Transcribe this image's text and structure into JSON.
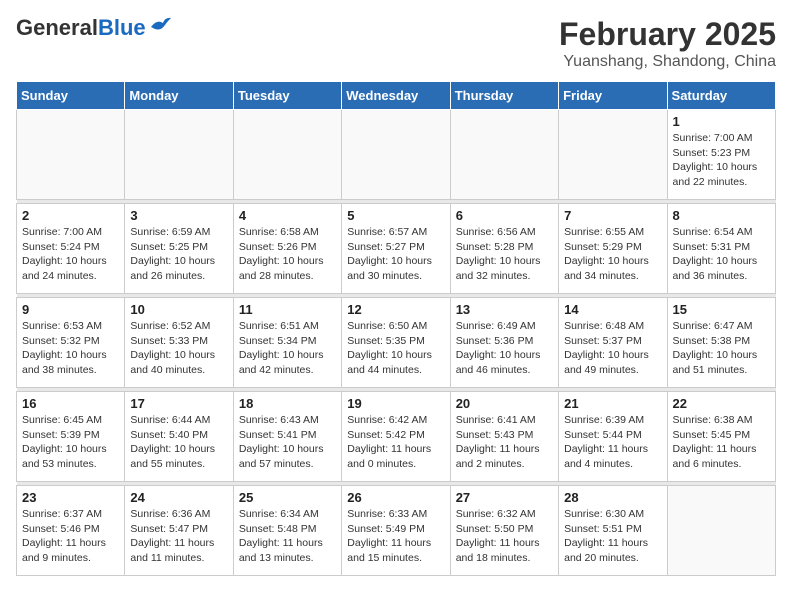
{
  "header": {
    "logo_general": "General",
    "logo_blue": "Blue",
    "month_year": "February 2025",
    "location": "Yuanshang, Shandong, China"
  },
  "weekdays": [
    "Sunday",
    "Monday",
    "Tuesday",
    "Wednesday",
    "Thursday",
    "Friday",
    "Saturday"
  ],
  "weeks": [
    [
      {
        "day": "",
        "info": ""
      },
      {
        "day": "",
        "info": ""
      },
      {
        "day": "",
        "info": ""
      },
      {
        "day": "",
        "info": ""
      },
      {
        "day": "",
        "info": ""
      },
      {
        "day": "",
        "info": ""
      },
      {
        "day": "1",
        "info": "Sunrise: 7:00 AM\nSunset: 5:23 PM\nDaylight: 10 hours\nand 22 minutes."
      }
    ],
    [
      {
        "day": "2",
        "info": "Sunrise: 7:00 AM\nSunset: 5:24 PM\nDaylight: 10 hours\nand 24 minutes."
      },
      {
        "day": "3",
        "info": "Sunrise: 6:59 AM\nSunset: 5:25 PM\nDaylight: 10 hours\nand 26 minutes."
      },
      {
        "day": "4",
        "info": "Sunrise: 6:58 AM\nSunset: 5:26 PM\nDaylight: 10 hours\nand 28 minutes."
      },
      {
        "day": "5",
        "info": "Sunrise: 6:57 AM\nSunset: 5:27 PM\nDaylight: 10 hours\nand 30 minutes."
      },
      {
        "day": "6",
        "info": "Sunrise: 6:56 AM\nSunset: 5:28 PM\nDaylight: 10 hours\nand 32 minutes."
      },
      {
        "day": "7",
        "info": "Sunrise: 6:55 AM\nSunset: 5:29 PM\nDaylight: 10 hours\nand 34 minutes."
      },
      {
        "day": "8",
        "info": "Sunrise: 6:54 AM\nSunset: 5:31 PM\nDaylight: 10 hours\nand 36 minutes."
      }
    ],
    [
      {
        "day": "9",
        "info": "Sunrise: 6:53 AM\nSunset: 5:32 PM\nDaylight: 10 hours\nand 38 minutes."
      },
      {
        "day": "10",
        "info": "Sunrise: 6:52 AM\nSunset: 5:33 PM\nDaylight: 10 hours\nand 40 minutes."
      },
      {
        "day": "11",
        "info": "Sunrise: 6:51 AM\nSunset: 5:34 PM\nDaylight: 10 hours\nand 42 minutes."
      },
      {
        "day": "12",
        "info": "Sunrise: 6:50 AM\nSunset: 5:35 PM\nDaylight: 10 hours\nand 44 minutes."
      },
      {
        "day": "13",
        "info": "Sunrise: 6:49 AM\nSunset: 5:36 PM\nDaylight: 10 hours\nand 46 minutes."
      },
      {
        "day": "14",
        "info": "Sunrise: 6:48 AM\nSunset: 5:37 PM\nDaylight: 10 hours\nand 49 minutes."
      },
      {
        "day": "15",
        "info": "Sunrise: 6:47 AM\nSunset: 5:38 PM\nDaylight: 10 hours\nand 51 minutes."
      }
    ],
    [
      {
        "day": "16",
        "info": "Sunrise: 6:45 AM\nSunset: 5:39 PM\nDaylight: 10 hours\nand 53 minutes."
      },
      {
        "day": "17",
        "info": "Sunrise: 6:44 AM\nSunset: 5:40 PM\nDaylight: 10 hours\nand 55 minutes."
      },
      {
        "day": "18",
        "info": "Sunrise: 6:43 AM\nSunset: 5:41 PM\nDaylight: 10 hours\nand 57 minutes."
      },
      {
        "day": "19",
        "info": "Sunrise: 6:42 AM\nSunset: 5:42 PM\nDaylight: 11 hours\nand 0 minutes."
      },
      {
        "day": "20",
        "info": "Sunrise: 6:41 AM\nSunset: 5:43 PM\nDaylight: 11 hours\nand 2 minutes."
      },
      {
        "day": "21",
        "info": "Sunrise: 6:39 AM\nSunset: 5:44 PM\nDaylight: 11 hours\nand 4 minutes."
      },
      {
        "day": "22",
        "info": "Sunrise: 6:38 AM\nSunset: 5:45 PM\nDaylight: 11 hours\nand 6 minutes."
      }
    ],
    [
      {
        "day": "23",
        "info": "Sunrise: 6:37 AM\nSunset: 5:46 PM\nDaylight: 11 hours\nand 9 minutes."
      },
      {
        "day": "24",
        "info": "Sunrise: 6:36 AM\nSunset: 5:47 PM\nDaylight: 11 hours\nand 11 minutes."
      },
      {
        "day": "25",
        "info": "Sunrise: 6:34 AM\nSunset: 5:48 PM\nDaylight: 11 hours\nand 13 minutes."
      },
      {
        "day": "26",
        "info": "Sunrise: 6:33 AM\nSunset: 5:49 PM\nDaylight: 11 hours\nand 15 minutes."
      },
      {
        "day": "27",
        "info": "Sunrise: 6:32 AM\nSunset: 5:50 PM\nDaylight: 11 hours\nand 18 minutes."
      },
      {
        "day": "28",
        "info": "Sunrise: 6:30 AM\nSunset: 5:51 PM\nDaylight: 11 hours\nand 20 minutes."
      },
      {
        "day": "",
        "info": ""
      }
    ]
  ]
}
